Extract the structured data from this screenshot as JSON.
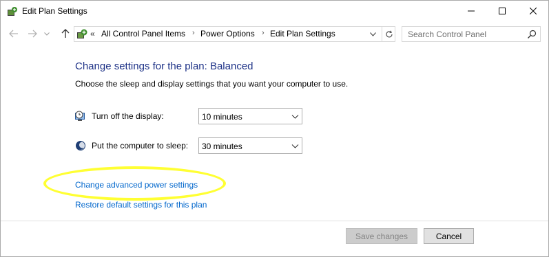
{
  "window": {
    "title": "Edit Plan Settings",
    "icon": "power-options-icon",
    "controls": [
      "minimize-icon",
      "maximize-icon",
      "close-icon"
    ]
  },
  "nav": {
    "breadcrumb_overflow": "«",
    "breadcrumbs": [
      "All Control Panel Items",
      "Power Options",
      "Edit Plan Settings"
    ],
    "search_placeholder": "Search Control Panel"
  },
  "content": {
    "title": "Change settings for the plan: Balanced",
    "description": "Choose the sleep and display settings that you want your computer to use.",
    "settings": [
      {
        "label": "Turn off the display:",
        "value": "10 minutes",
        "icon": "monitor-clock-icon"
      },
      {
        "label": "Put the computer to sleep:",
        "value": "30 minutes",
        "icon": "moon-icon"
      }
    ],
    "links": {
      "advanced": "Change advanced power settings",
      "restore": "Restore default settings for this plan"
    },
    "annotation_color": "#ffff33"
  },
  "footer": {
    "save_label": "Save changes",
    "cancel_label": "Cancel"
  },
  "colors": {
    "title": "#1e3287",
    "link": "#0066cc"
  }
}
